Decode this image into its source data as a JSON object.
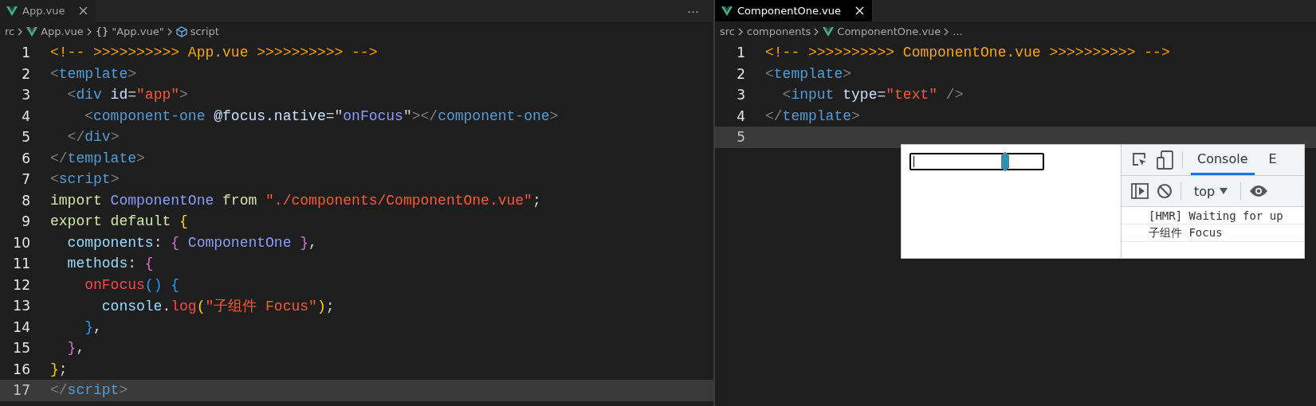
{
  "panes": [
    {
      "tab": {
        "label": "App.vue",
        "selected": false
      },
      "more_actions": "···",
      "breadcrumbs": [
        {
          "kind": "folder",
          "label": "rc"
        },
        {
          "kind": "file",
          "label": "App.vue"
        },
        {
          "kind": "symbol",
          "label": "\"App.vue\"",
          "symbol": "{}"
        },
        {
          "kind": "element",
          "label": "script"
        }
      ],
      "lines": [
        {
          "number": "1",
          "current": false,
          "tokens": [
            {
              "kind": "comment",
              "text": "<!-- >>>>>>>>>> App.vue >>>>>>>>>> -->"
            }
          ]
        },
        {
          "number": "2",
          "current": false,
          "tokens": [
            {
              "kind": "bracket",
              "text": "<"
            },
            {
              "kind": "tag",
              "text": "template"
            },
            {
              "kind": "bracket",
              "text": ">"
            }
          ]
        },
        {
          "number": "3",
          "current": false,
          "tokens": [
            {
              "kind": "bracket",
              "text": "  <"
            },
            {
              "kind": "tag",
              "text": "div"
            },
            {
              "kind": "attr",
              "text": " id"
            },
            {
              "kind": "punct",
              "text": "="
            },
            {
              "kind": "string",
              "text": "\"app\""
            },
            {
              "kind": "bracket",
              "text": ">"
            }
          ]
        },
        {
          "number": "4",
          "current": false,
          "tokens": [
            {
              "kind": "bracket",
              "text": "    <"
            },
            {
              "kind": "tag",
              "text": "component-one"
            },
            {
              "kind": "attr",
              "text": " @focus.native"
            },
            {
              "kind": "punct",
              "text": "=\""
            },
            {
              "kind": "class",
              "text": "onFocus"
            },
            {
              "kind": "punct",
              "text": "\""
            },
            {
              "kind": "bracket",
              "text": "></"
            },
            {
              "kind": "tag",
              "text": "component-one"
            },
            {
              "kind": "bracket",
              "text": ">"
            }
          ]
        },
        {
          "number": "5",
          "current": false,
          "tokens": [
            {
              "kind": "bracket",
              "text": "  </"
            },
            {
              "kind": "tag",
              "text": "div"
            },
            {
              "kind": "bracket",
              "text": ">"
            }
          ]
        },
        {
          "number": "6",
          "current": false,
          "tokens": [
            {
              "kind": "bracket",
              "text": "</"
            },
            {
              "kind": "tag",
              "text": "template"
            },
            {
              "kind": "bracket",
              "text": ">"
            }
          ]
        },
        {
          "number": "7",
          "current": false,
          "tokens": [
            {
              "kind": "bracket",
              "text": "<"
            },
            {
              "kind": "tag",
              "text": "script"
            },
            {
              "kind": "bracket",
              "text": ">"
            }
          ]
        },
        {
          "number": "8",
          "current": false,
          "tokens": [
            {
              "kind": "keyword",
              "text": "import"
            },
            {
              "kind": "class",
              "text": " ComponentOne"
            },
            {
              "kind": "keyword",
              "text": " from"
            },
            {
              "kind": "string",
              "text": " \"./components/ComponentOne.vue\""
            },
            {
              "kind": "punct",
              "text": ";"
            }
          ]
        },
        {
          "number": "9",
          "current": false,
          "tokens": [
            {
              "kind": "keyword",
              "text": "export default"
            },
            {
              "kind": "brace1",
              "text": " {"
            }
          ]
        },
        {
          "number": "10",
          "current": false,
          "tokens": [
            {
              "kind": "prop",
              "text": "  components"
            },
            {
              "kind": "punct",
              "text": ":"
            },
            {
              "kind": "brace2",
              "text": " {"
            },
            {
              "kind": "class",
              "text": " ComponentOne"
            },
            {
              "kind": "brace2",
              "text": " }"
            },
            {
              "kind": "punct",
              "text": ","
            }
          ]
        },
        {
          "number": "11",
          "current": false,
          "tokens": [
            {
              "kind": "prop",
              "text": "  methods"
            },
            {
              "kind": "punct",
              "text": ":"
            },
            {
              "kind": "brace2",
              "text": " {"
            }
          ]
        },
        {
          "number": "12",
          "current": false,
          "tokens": [
            {
              "kind": "func",
              "text": "    onFocus"
            },
            {
              "kind": "brace3",
              "text": "() {"
            }
          ]
        },
        {
          "number": "13",
          "current": false,
          "tokens": [
            {
              "kind": "prop",
              "text": "      console"
            },
            {
              "kind": "punct",
              "text": "."
            },
            {
              "kind": "func",
              "text": "log"
            },
            {
              "kind": "brace1",
              "text": "("
            },
            {
              "kind": "string",
              "text": "\"子组件 Focus\""
            },
            {
              "kind": "brace1",
              "text": ")"
            },
            {
              "kind": "punct",
              "text": ";"
            }
          ]
        },
        {
          "number": "14",
          "current": false,
          "tokens": [
            {
              "kind": "brace3",
              "text": "    }"
            },
            {
              "kind": "punct",
              "text": ","
            }
          ]
        },
        {
          "number": "15",
          "current": false,
          "tokens": [
            {
              "kind": "brace2",
              "text": "  }"
            },
            {
              "kind": "punct",
              "text": ","
            }
          ]
        },
        {
          "number": "16",
          "current": false,
          "tokens": [
            {
              "kind": "brace1",
              "text": "}"
            },
            {
              "kind": "punct",
              "text": ";"
            }
          ]
        },
        {
          "number": "17",
          "current": true,
          "tokens": [
            {
              "kind": "bracket",
              "text": "</"
            },
            {
              "kind": "tag",
              "text": "script"
            },
            {
              "kind": "bracket",
              "text": ">"
            }
          ]
        }
      ]
    },
    {
      "tab": {
        "label": "ComponentOne.vue",
        "selected": true
      },
      "breadcrumbs": [
        {
          "kind": "folder",
          "label": "src"
        },
        {
          "kind": "folder",
          "label": "components"
        },
        {
          "kind": "file",
          "label": "ComponentOne.vue"
        },
        {
          "kind": "folder",
          "label": "..."
        }
      ],
      "lines": [
        {
          "number": "1",
          "current": false,
          "tokens": [
            {
              "kind": "comment",
              "text": "<!-- >>>>>>>>>> ComponentOne.vue >>>>>>>>>> -->"
            }
          ]
        },
        {
          "number": "2",
          "current": false,
          "tokens": [
            {
              "kind": "bracket",
              "text": "<"
            },
            {
              "kind": "tag",
              "text": "template"
            },
            {
              "kind": "bracket",
              "text": ">"
            }
          ]
        },
        {
          "number": "3",
          "current": false,
          "tokens": [
            {
              "kind": "bracket",
              "text": "  <"
            },
            {
              "kind": "tag",
              "text": "input"
            },
            {
              "kind": "attr",
              "text": " type"
            },
            {
              "kind": "punct",
              "text": "="
            },
            {
              "kind": "string",
              "text": "\"text\""
            },
            {
              "kind": "bracket",
              "text": " />"
            }
          ]
        },
        {
          "number": "4",
          "current": false,
          "tokens": [
            {
              "kind": "bracket",
              "text": "</"
            },
            {
              "kind": "tag",
              "text": "template"
            },
            {
              "kind": "bracket",
              "text": ">"
            }
          ]
        },
        {
          "number": "5",
          "current": true
        }
      ]
    }
  ],
  "browser": {
    "devtools": {
      "tabs": [
        {
          "label": "Console",
          "selected": true
        },
        {
          "label": "E",
          "selected": false
        }
      ],
      "context": "top",
      "messages": [
        "[HMR] Waiting for up",
        "子组件 Focus"
      ]
    }
  }
}
